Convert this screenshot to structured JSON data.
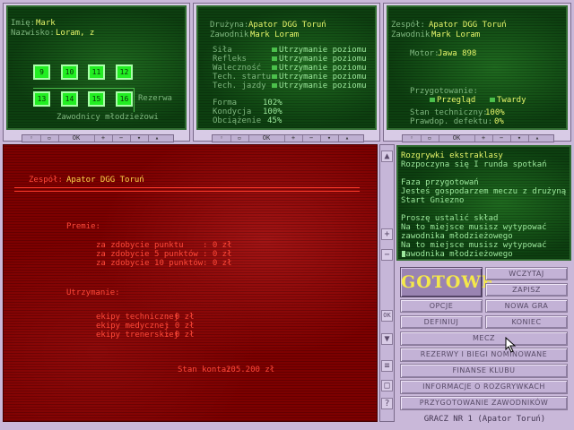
{
  "panel1": {
    "imie_label": "Imię:",
    "imie_value": "Mark",
    "nazwisko_label": "Nazwisko:",
    "nazwisko_value": "Loram, z",
    "squares": [
      "9",
      "10",
      "11",
      "12",
      "13",
      "14",
      "15",
      "16"
    ],
    "rezerwa_label": "Rezerwa",
    "zawodnicy_label": "Zawodnicy młodzieżowi"
  },
  "panel2": {
    "druzyna_label": "Drużyna:",
    "druzyna_value": "Apator DGG Toruń",
    "zawodnik_label": "Zawodnik:",
    "zawodnik_value": "Mark Loram",
    "skills": [
      {
        "label": "Siła",
        "value": "Utrzymanie poziomu"
      },
      {
        "label": "Refleks",
        "value": "Utrzymanie poziomu"
      },
      {
        "label": "Waleczność",
        "value": "Utrzymanie poziomu"
      },
      {
        "label": "Tech. startu",
        "value": "Utrzymanie poziomu"
      },
      {
        "label": "Tech. jazdy",
        "value": "Utrzymanie poziomu"
      }
    ],
    "stats": [
      {
        "label": "Forma",
        "value": "102%"
      },
      {
        "label": "Kondycja",
        "value": "100%"
      },
      {
        "label": "Obciążenie",
        "value": "45%"
      }
    ]
  },
  "panel3": {
    "zespol_label": "Zespół:",
    "zespol_value": "Apator DGG Toruń",
    "zawodnik_label": "Zawodnik:",
    "zawodnik_value": "Mark Loram",
    "motor_label": "Motor:",
    "motor_value": "Jawa 898",
    "przygotowanie_label": "Przygotowanie:",
    "opt1": "Przegląd",
    "opt2": "Twardy",
    "stan_label": "Stan techniczny:",
    "stan_value": "100%",
    "prawdop_label": "Prawdop. defektu:",
    "prawdop_value": "0%"
  },
  "controls": [
    "OK",
    "+",
    "−"
  ],
  "main": {
    "zespol_label": "Zespół:",
    "zespol_value": "Apator DGG Toruń",
    "premie_title": "Premie:",
    "premie": [
      {
        "label": "za zdobycie punktu",
        "value": ": 0 zł"
      },
      {
        "label": "za zdobycie 5 punktów",
        "value": ": 0 zł"
      },
      {
        "label": "za zdobycie 10 punktów",
        "value": ": 0 zł"
      }
    ],
    "utrzymanie_title": "Utrzymanie:",
    "utrzymanie": [
      {
        "label": "ekipy technicznej",
        "value": ": 0 zł"
      },
      {
        "label": "ekipy medycznej",
        "value": ": 0 zł"
      },
      {
        "label": "ekipy trenerskiej",
        "value": ": 0 zł"
      }
    ],
    "stan_konta_label": "Stan konta:",
    "stan_konta_value": "205.200 zł"
  },
  "messages": {
    "lines": [
      "Rozgrywki ekstraklasy",
      "Rozpoczyna się I runda spotkań",
      "",
      "Faza przygotowań",
      "Jesteś gospodarzem meczu z drużyną",
      "Start Gniezno",
      "",
      "Proszę ustalić skład",
      "Na to miejsce musisz wytypować",
      "zawodnika młodzieżowego",
      "Na to miejsce musisz wytypować",
      "zawodnika młodzieżowego"
    ]
  },
  "menu": {
    "gotowe": "GOTOWE",
    "wczytaj": "WCZYTAJ",
    "zapisz": "ZAPISZ",
    "opcje": "OPCJE",
    "nowa_gra": "NOWA GRA",
    "definiuj": "DEFINIUJ",
    "koniec": "KONIEC",
    "mecz": "MECZ",
    "rezerwy": "REZERWY I BIEGI NOMINOWANE",
    "finanse": "FINANSE KLUBU",
    "informacje": "INFORMACJE O ROZGRYWKACH",
    "przygotowanie": "PRZYGOTOWANIE ZAWODNIKÓW"
  },
  "footer": "GRACZ NR 1   (Apator Toruń)",
  "colors": {
    "panel_green": "#0a3a0e",
    "text_yellow": "#e6f56a",
    "red_panel": "#7d0000",
    "button": "#c3b2d6"
  },
  "icons": [
    "up-arrow-icon",
    "plus-icon",
    "minus-icon",
    "down-arrow-icon",
    "ok-icon",
    "scroll-icon",
    "question-icon",
    "cursor-icon"
  ]
}
